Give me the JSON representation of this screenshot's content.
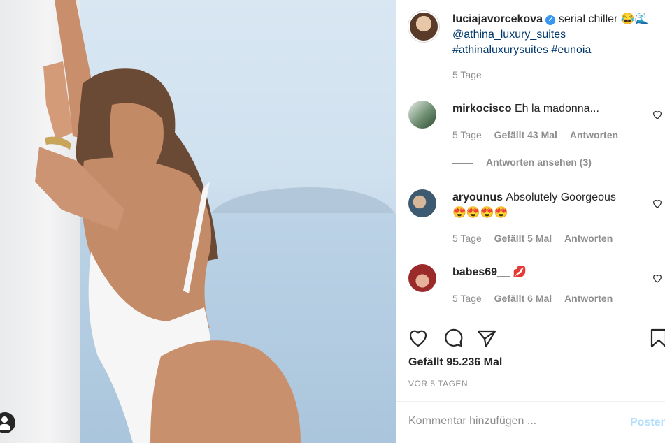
{
  "post": {
    "author": "luciajavorcekova",
    "caption_text": "serial chiller 😂🌊",
    "mention": "@athina_luxury_suites",
    "hashtags": "#athinaluxurysuites #eunoia",
    "age": "5 Tage"
  },
  "comments": [
    {
      "user": "mirkocisco",
      "text": "Eh la madonna...",
      "age": "5 Tage",
      "likes": "Gefällt 43 Mal",
      "reply": "Antworten"
    },
    {
      "user": "aryounus",
      "text": "Absolutely Goorgeous",
      "text2": "😍😍😍😍",
      "age": "5 Tage",
      "likes": "Gefällt 5 Mal",
      "reply": "Antworten"
    },
    {
      "user": "babes69__",
      "text": "💋",
      "age": "5 Tage",
      "likes": "Gefällt 6 Mal",
      "reply": "Antworten"
    }
  ],
  "view_replies": "Antworten ansehen (3)",
  "likes_total": "Gefällt 95.236 Mal",
  "post_date": "VOR 5 TAGEN",
  "comment_box": {
    "placeholder": "Kommentar hinzufügen ...",
    "post_label": "Posten"
  },
  "icons": [
    "heart-icon",
    "comment-icon",
    "share-icon",
    "bookmark-icon",
    "user-tag-icon",
    "verified-badge-icon"
  ],
  "colors": {
    "link": "#00376b",
    "verified": "#3897f0",
    "muted": "#8e8e8e",
    "post_button": "#b2dffc"
  }
}
